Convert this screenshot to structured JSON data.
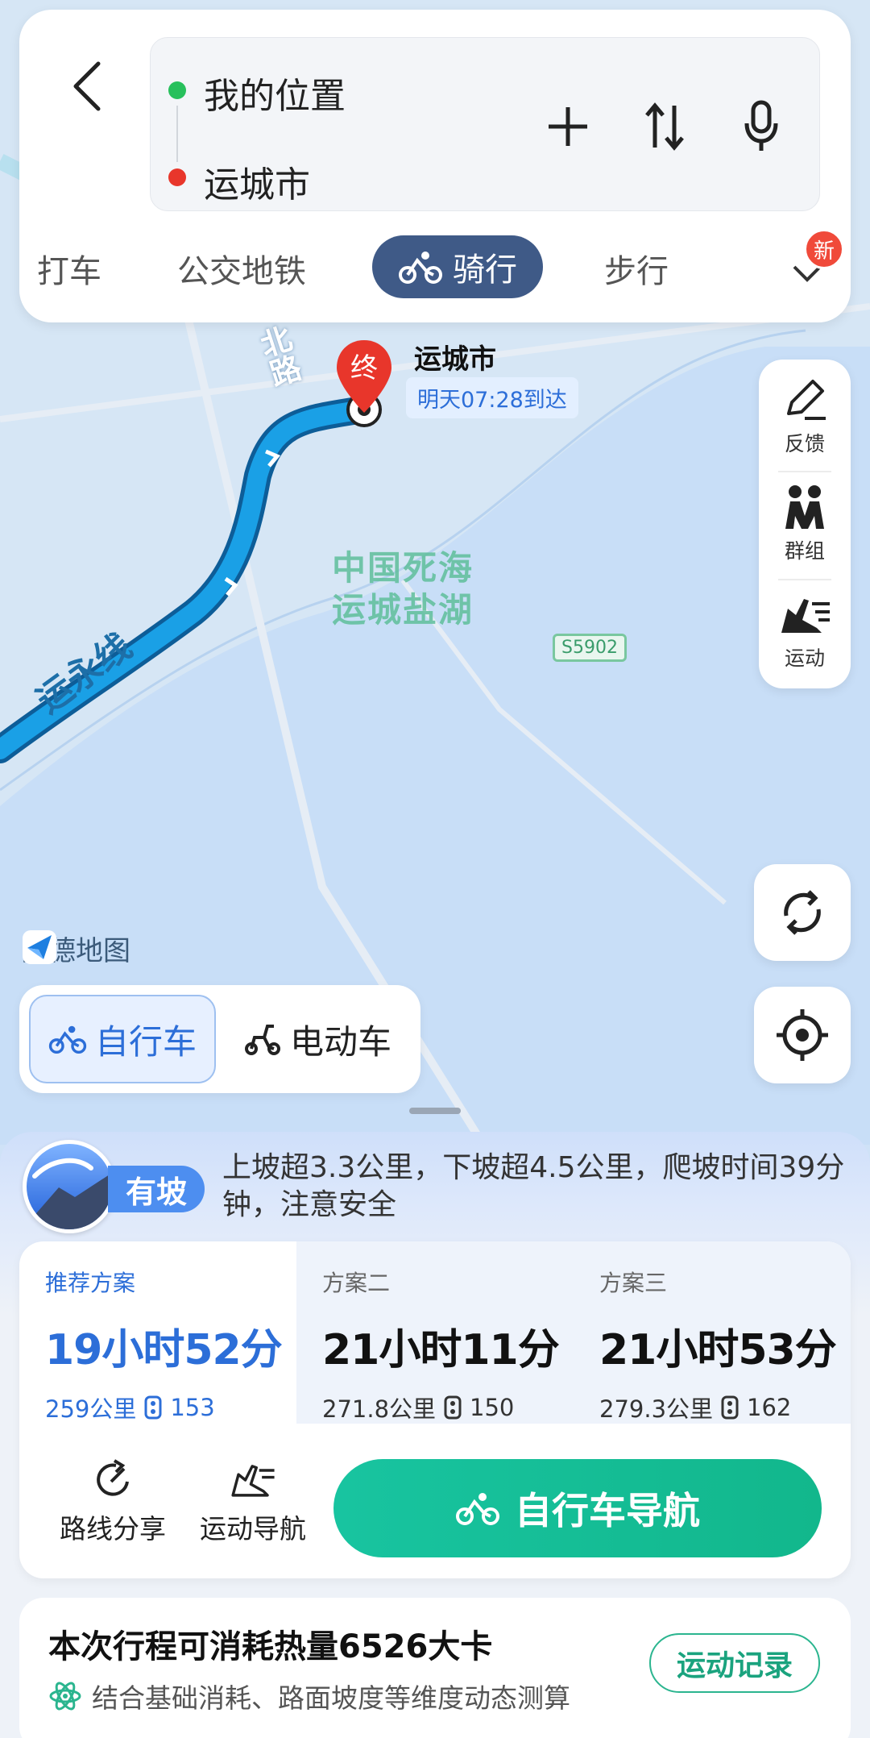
{
  "search": {
    "origin": "我的位置",
    "destination": "运城市"
  },
  "mode_tabs": [
    {
      "label": "打车"
    },
    {
      "label": "公交地铁"
    },
    {
      "label": "骑行"
    },
    {
      "label": "步行"
    }
  ],
  "mode_more_badge": "新",
  "map": {
    "area_label_line1": "中国死海",
    "area_label_line2": "运城盐湖",
    "road_shield": "S5902",
    "road_name": "运永线",
    "top_road_name": "北路",
    "destination_title": "运城市",
    "destination_eta": "明天07:28到达",
    "end_marker": "终",
    "watermark": "高德地图"
  },
  "side_tools": [
    {
      "label": "反馈"
    },
    {
      "label": "群组"
    },
    {
      "label": "运动"
    }
  ],
  "vehicle": {
    "bike": "自行车",
    "ebike": "电动车"
  },
  "slope": {
    "badge": "有坡",
    "text": "上坡超3.3公里，下坡超4.5公里，爬坡时间39分钟，注意安全"
  },
  "plans": [
    {
      "label": "推荐方案",
      "duration": "19小时52分",
      "distance": "259公里",
      "lights": "153"
    },
    {
      "label": "方案二",
      "duration": "21小时11分",
      "distance": "271.8公里",
      "lights": "150"
    },
    {
      "label": "方案三",
      "duration": "21小时53分",
      "distance": "279.3公里",
      "lights": "162"
    }
  ],
  "actions": {
    "share": "路线分享",
    "sport_nav": "运动导航",
    "bike_nav": "自行车导航"
  },
  "calories": {
    "title": "本次行程可消耗热量6526大卡",
    "subtitle": "结合基础消耗、路面坡度等维度动态测算",
    "button": "运动记录"
  },
  "colors": {
    "accent_blue": "#2c6ed8",
    "active_tab": "#3f5a87",
    "nav_green": "#12b78c",
    "route_line": "#1aa0e6"
  }
}
